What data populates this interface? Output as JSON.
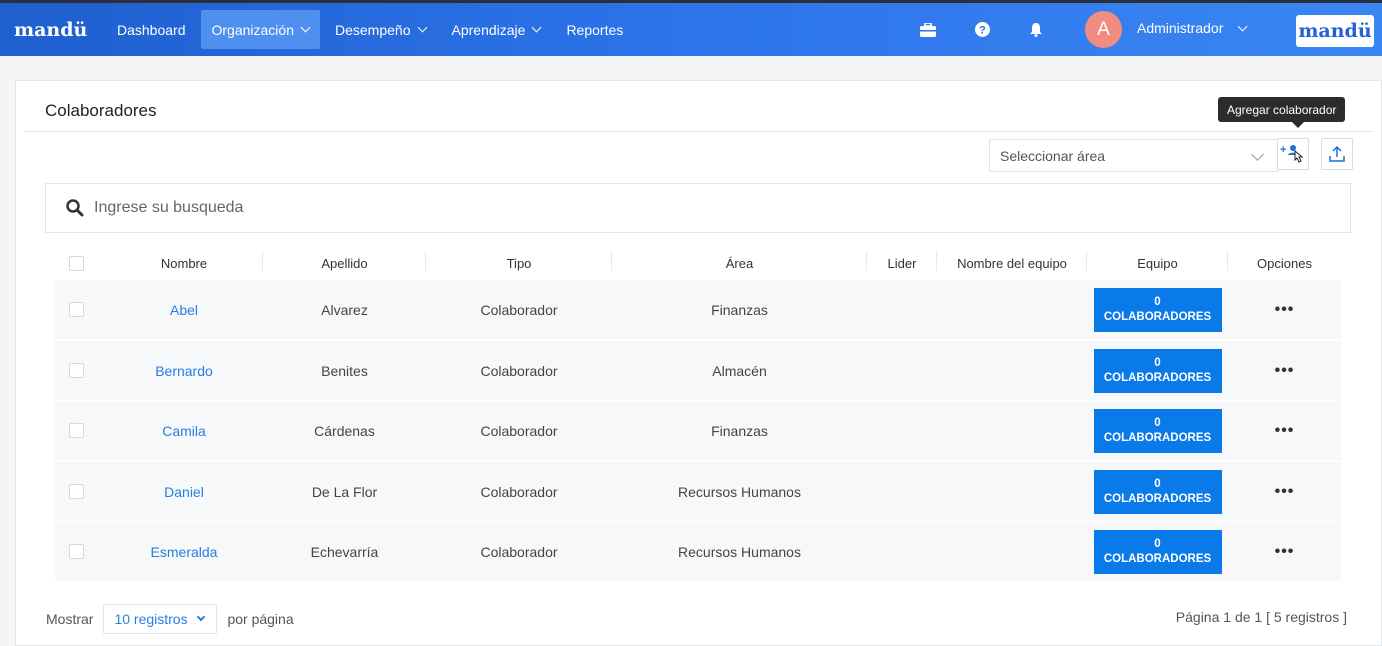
{
  "nav": {
    "brand": "mandü",
    "items": [
      {
        "label": "Dashboard",
        "dropdown": false,
        "active": false
      },
      {
        "label": "Organización",
        "dropdown": true,
        "active": true
      },
      {
        "label": "Desempeño",
        "dropdown": true,
        "active": false
      },
      {
        "label": "Aprendizaje",
        "dropdown": true,
        "active": false
      },
      {
        "label": "Reportes",
        "dropdown": false,
        "active": false
      }
    ],
    "icons": [
      "briefcase-icon",
      "help-icon",
      "bell-icon"
    ],
    "avatar_initial": "A",
    "user": "Administrador",
    "brand_logo": "mandü"
  },
  "page": {
    "title": "Colaboradores",
    "tooltip": "Agregar colaborador",
    "area_select": "Seleccionar área",
    "search_placeholder": "Ingrese su busqueda"
  },
  "table": {
    "headers": [
      "Nombre",
      "Apellido",
      "Tipo",
      "Área",
      "Lider",
      "Nombre del equipo",
      "Equipo",
      "Opciones"
    ],
    "rows": [
      {
        "nombre": "Abel",
        "apellido": "Alvarez",
        "tipo": "Colaborador",
        "area": "Finanzas",
        "lider": "",
        "equipo_nombre": "",
        "equipo_count": "0",
        "equipo_label": "COLABORADORES"
      },
      {
        "nombre": "Bernardo",
        "apellido": "Benites",
        "tipo": "Colaborador",
        "area": "Almacén",
        "lider": "",
        "equipo_nombre": "",
        "equipo_count": "0",
        "equipo_label": "COLABORADORES"
      },
      {
        "nombre": "Camila",
        "apellido": "Cárdenas",
        "tipo": "Colaborador",
        "area": "Finanzas",
        "lider": "",
        "equipo_nombre": "",
        "equipo_count": "0",
        "equipo_label": "COLABORADORES"
      },
      {
        "nombre": "Daniel",
        "apellido": "De La Flor",
        "tipo": "Colaborador",
        "area": "Recursos Humanos",
        "lider": "",
        "equipo_nombre": "",
        "equipo_count": "0",
        "equipo_label": "COLABORADORES"
      },
      {
        "nombre": "Esmeralda",
        "apellido": "Echevarría",
        "tipo": "Colaborador",
        "area": "Recursos Humanos",
        "lider": "",
        "equipo_nombre": "",
        "equipo_count": "0",
        "equipo_label": "COLABORADORES"
      }
    ],
    "options_glyph": "•••"
  },
  "footer": {
    "show_label": "Mostrar",
    "per_page_value": "10 registros",
    "per_page_suffix": "por página",
    "pagination": "Página 1 de 1 [ 5 registros ]"
  },
  "colors": {
    "accent": "#2b7de0",
    "nav": "#2d74ea",
    "team_button": "#0a7ae8"
  }
}
